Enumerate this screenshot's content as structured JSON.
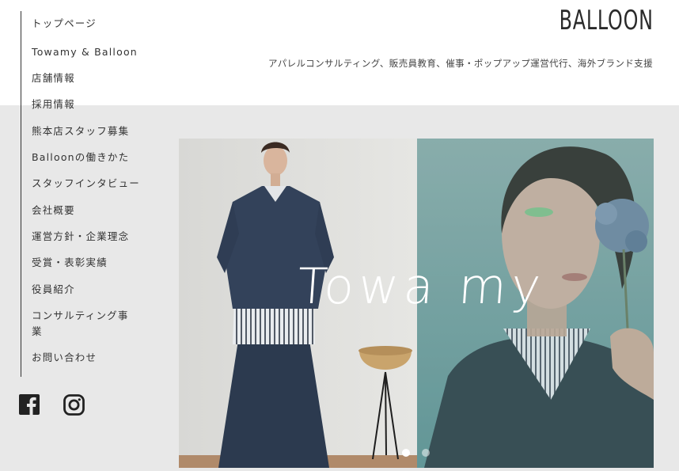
{
  "brand": {
    "logo": "BALLOON",
    "tagline": "アパレルコンサルティング、販売員教育、催事・ポップアップ運営代行、海外ブランド支援"
  },
  "nav": {
    "items": [
      {
        "label": "トップページ"
      },
      {
        "label": "Towamy & Balloon"
      },
      {
        "label": "店舗情報"
      },
      {
        "label": "採用情報"
      },
      {
        "label": "熊本店スタッフ募集"
      },
      {
        "label": "Balloonの働きかた"
      },
      {
        "label": "スタッフインタビュー"
      },
      {
        "label": "会社概要"
      },
      {
        "label": "運営方針・企業理念"
      },
      {
        "label": "受賞・表彰実績"
      },
      {
        "label": "役員紹介"
      },
      {
        "label": "コンサルティング事業"
      },
      {
        "label": "お問い合わせ"
      }
    ]
  },
  "social": {
    "facebook_icon": "facebook-icon",
    "instagram_icon": "instagram-icon"
  },
  "hero": {
    "title": "Towa my",
    "slide_count": 2,
    "active_slide": 1
  },
  "colors": {
    "header_bg": "#ffffff",
    "content_bg": "#e8e8e8",
    "text": "#333333",
    "hero_overlay": "#6f9ea0"
  }
}
